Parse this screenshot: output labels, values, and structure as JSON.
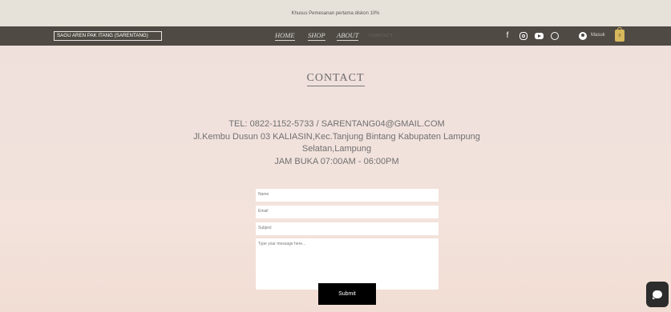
{
  "announcement": "Khusus Pemesanan pertama diskon 10%",
  "header": {
    "brand": "SAGU AREN PAK ITANG (SARENTANG)",
    "nav": [
      "HOME",
      "SHOP",
      "ABOUT",
      "CONTACT"
    ],
    "social_icons": [
      "facebook-icon",
      "instagram-icon",
      "youtube-icon",
      "whatsapp-icon"
    ],
    "login": "Masuk",
    "cart_count": "0"
  },
  "page": {
    "title": "CONTACT",
    "phone_email": "TEL: 0822-1152-5733 / SARENTANG04@GMAIL.COM",
    "address": "Jl.Kembu Dusun 03 KALIASIN,Kec.Tanjung Bintang Kabupaten Lampung Selatan,Lampung",
    "hours": "JAM BUKA 07:00AM - 06:00PM"
  },
  "form": {
    "name_placeholder": "Name",
    "email_placeholder": "Email",
    "subject_placeholder": "Subject",
    "message_placeholder": "Type your message here...",
    "submit_label": "Submit"
  },
  "colors": {
    "navbar": "#4f4a44",
    "announcement_bg": "#e7e2d9",
    "cart": "#d8b85c"
  }
}
